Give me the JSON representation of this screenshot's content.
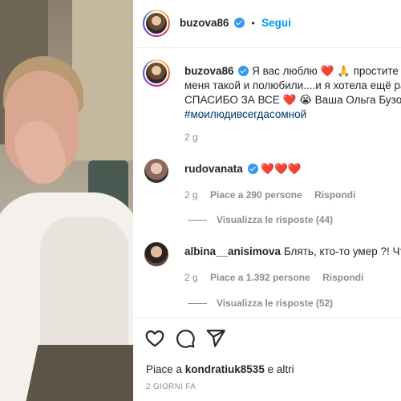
{
  "post": {
    "username": "buzova86",
    "follow_label": "Segui",
    "separator": "•"
  },
  "caption": {
    "username": "buzova86",
    "line1": "Я вас люблю ❤️ 🙏 простите за",
    "line2": "меня такой и полюбили....и я хотела ещё ра",
    "line3": "СПАСИБО ЗА ВСЕ ❤️ 😭 Ваша Ольга Бузова",
    "hashtag": "#моилюдивсегдасомной",
    "time": "2 g"
  },
  "comments": [
    {
      "username": "rudovanata",
      "text": "❤️❤️❤️",
      "time": "2 g",
      "likes": "Piace a 290 persone",
      "reply": "Rispondi",
      "view_replies": "Visualizza le risposte (44)"
    },
    {
      "username": "albina__anisimova",
      "text": "Блять, кто-то умер ?! Что",
      "time": "2 g",
      "likes": "Piace a 1.392 persone",
      "reply": "Rispondi",
      "view_replies": "Visualizza le risposte (52)"
    }
  ],
  "footer": {
    "likes_prefix": "Piace a ",
    "likes_user": "kondratiuk8535",
    "likes_suffix": " e altri",
    "timestamp": "2 GIORNI FA"
  },
  "icons": {
    "like": "heart-icon",
    "comment": "comment-icon",
    "share": "share-icon"
  },
  "colors": {
    "link_blue": "#0095f6",
    "verified_blue": "#3897f0",
    "hashtag": "#00376b",
    "muted": "#8e8e8e"
  }
}
